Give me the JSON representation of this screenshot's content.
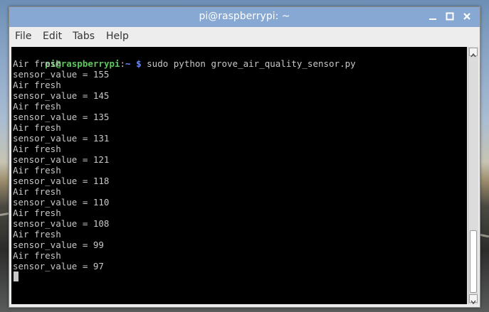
{
  "window": {
    "title": "pi@raspberrypi: ~",
    "titlebar_color": "#87a8d3",
    "controls": [
      "minimize-icon",
      "maximize-icon",
      "close-icon"
    ]
  },
  "menu": {
    "file": "File",
    "edit": "Edit",
    "tabs": "Tabs",
    "help": "Help"
  },
  "terminal": {
    "background": "#000000",
    "prompt_user": "pi@raspberrypi",
    "prompt_sep": ":",
    "prompt_path": "~ $",
    "command": " sudo python grove_air_quality_sensor.py",
    "lines": [
      "Air fresh",
      "sensor_value = 155",
      "Air fresh",
      "sensor_value = 145",
      "Air fresh",
      "sensor_value = 135",
      "Air fresh",
      "sensor_value = 131",
      "Air fresh",
      "sensor_value = 121",
      "Air fresh",
      "sensor_value = 118",
      "Air fresh",
      "sensor_value = 110",
      "Air fresh",
      "sensor_value = 108",
      "Air fresh",
      "sensor_value = 99",
      "Air fresh",
      "sensor_value = 97"
    ]
  },
  "scrollbar": {
    "position_fraction": 0.78
  }
}
